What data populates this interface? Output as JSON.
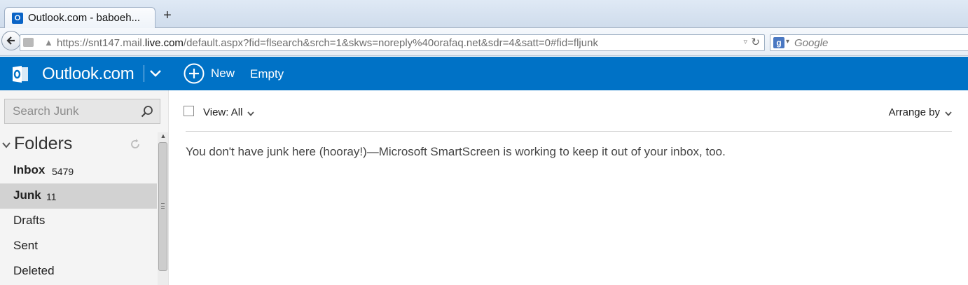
{
  "browser": {
    "tab_title": "Outlook.com - baboeh...",
    "new_tab_label": "+",
    "url_prefix": "https://snt147.mail.",
    "url_domain": "live.com",
    "url_suffix": "/default.aspx?fid=flsearch&srch=1&skws=noreply%40orafaq.net&sdr=4&satt=0#fid=fljunk",
    "search_placeholder": "Google"
  },
  "header": {
    "brand": "Outlook.com",
    "new_label": "New",
    "empty_label": "Empty",
    "accent_color": "#0072c6"
  },
  "sidebar": {
    "search_placeholder": "Search Junk",
    "folders_title": "Folders",
    "folders": [
      {
        "name": "Inbox",
        "count": "5479",
        "bold": true,
        "selected": false
      },
      {
        "name": "Junk",
        "count": "11",
        "bold": true,
        "selected": true
      },
      {
        "name": "Drafts",
        "count": "",
        "bold": false,
        "selected": false
      },
      {
        "name": "Sent",
        "count": "",
        "bold": false,
        "selected": false
      },
      {
        "name": "Deleted",
        "count": "",
        "bold": false,
        "selected": false
      }
    ]
  },
  "main": {
    "view_label": "View: All",
    "arrange_label": "Arrange by",
    "empty_message": "You don't have junk here (hooray!)—Microsoft SmartScreen is working to keep it out of your inbox, too."
  }
}
